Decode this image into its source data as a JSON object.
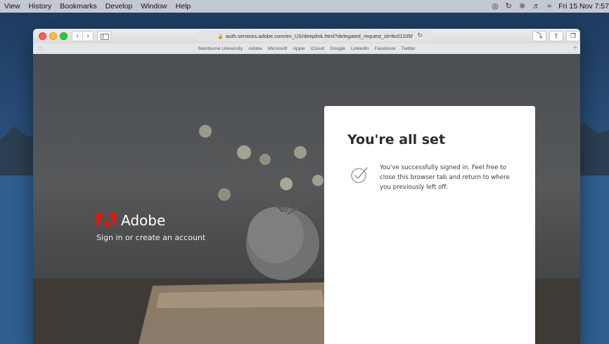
{
  "menubar": {
    "items": [
      "View",
      "History",
      "Bookmarks",
      "Develop",
      "Window",
      "Help"
    ],
    "clock": "Fri 15 Nov 7:57",
    "status_icons": [
      "siri-icon",
      "time-machine-icon",
      "bluetooth-icon",
      "volume-icon",
      "wifi-icon"
    ]
  },
  "browser": {
    "url": "auth.services.adobe.com/en_US/deeplink.html?delegated_request_id=8c01105f",
    "bookmarks": [
      "Swinburne University",
      "Adobe",
      "Microsoft",
      "Apple",
      "iCloud",
      "Google",
      "LinkedIn",
      "Facebook",
      "Twitter"
    ]
  },
  "brand": {
    "name": "Adobe",
    "tagline": "Sign in or create an account",
    "color": "#fa0f00"
  },
  "card": {
    "title": "You're all set",
    "message": "You've successfully signed in. Feel free to close this browser tab and return to where you previously left off."
  }
}
